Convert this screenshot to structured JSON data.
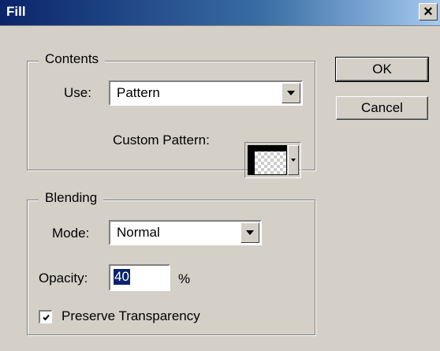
{
  "window": {
    "title": "Fill",
    "close_glyph": "×"
  },
  "contents": {
    "group_label": "Contents",
    "use_label": "Use:",
    "use_value": "Pattern",
    "custom_pattern_label": "Custom Pattern:"
  },
  "blending": {
    "group_label": "Blending",
    "mode_label": "Mode:",
    "mode_value": "Normal",
    "opacity_label": "Opacity:",
    "opacity_value": "40",
    "opacity_unit": "%",
    "preserve_label": "Preserve Transparency",
    "preserve_checked": true
  },
  "buttons": {
    "ok": "OK",
    "cancel": "Cancel"
  },
  "icons": {
    "close": "close-icon",
    "dropdown": "chevron-down-icon",
    "pattern": "pattern-swatch-icon",
    "check": "checkmark-icon"
  }
}
